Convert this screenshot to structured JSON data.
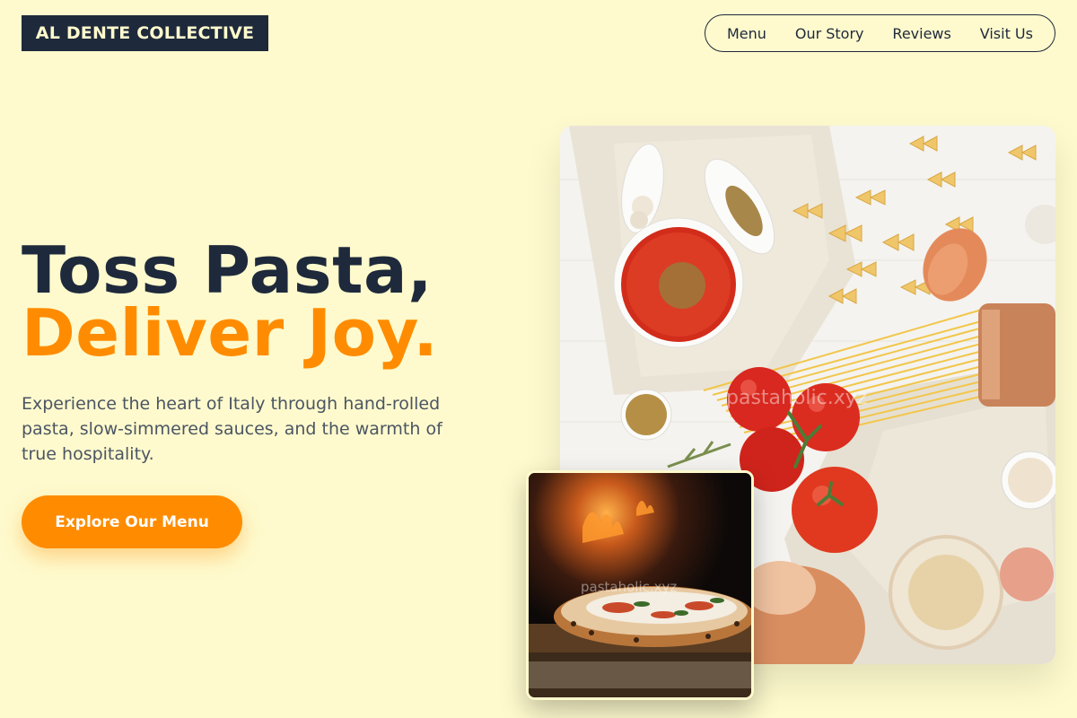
{
  "brand": {
    "logo_text": "AL DENTE COLLECTIVE"
  },
  "nav": {
    "items": [
      {
        "label": "Menu"
      },
      {
        "label": "Our Story"
      },
      {
        "label": "Reviews"
      },
      {
        "label": "Visit Us"
      }
    ]
  },
  "hero": {
    "headline_line1": "Toss Pasta,",
    "headline_line2": "Deliver Joy.",
    "lede": "Experience the heart of Italy through hand-rolled pasta, slow-simmered sauces, and the warmth of true hospitality.",
    "cta_label": "Explore Our Menu"
  },
  "images": {
    "main_watermark": "pastaholic.xyz",
    "small_watermark": "pastaholic.xyz"
  },
  "colors": {
    "background": "#fefacd",
    "navy": "#1e293b",
    "accent": "#ff8c00",
    "body_text": "#4b5563"
  }
}
